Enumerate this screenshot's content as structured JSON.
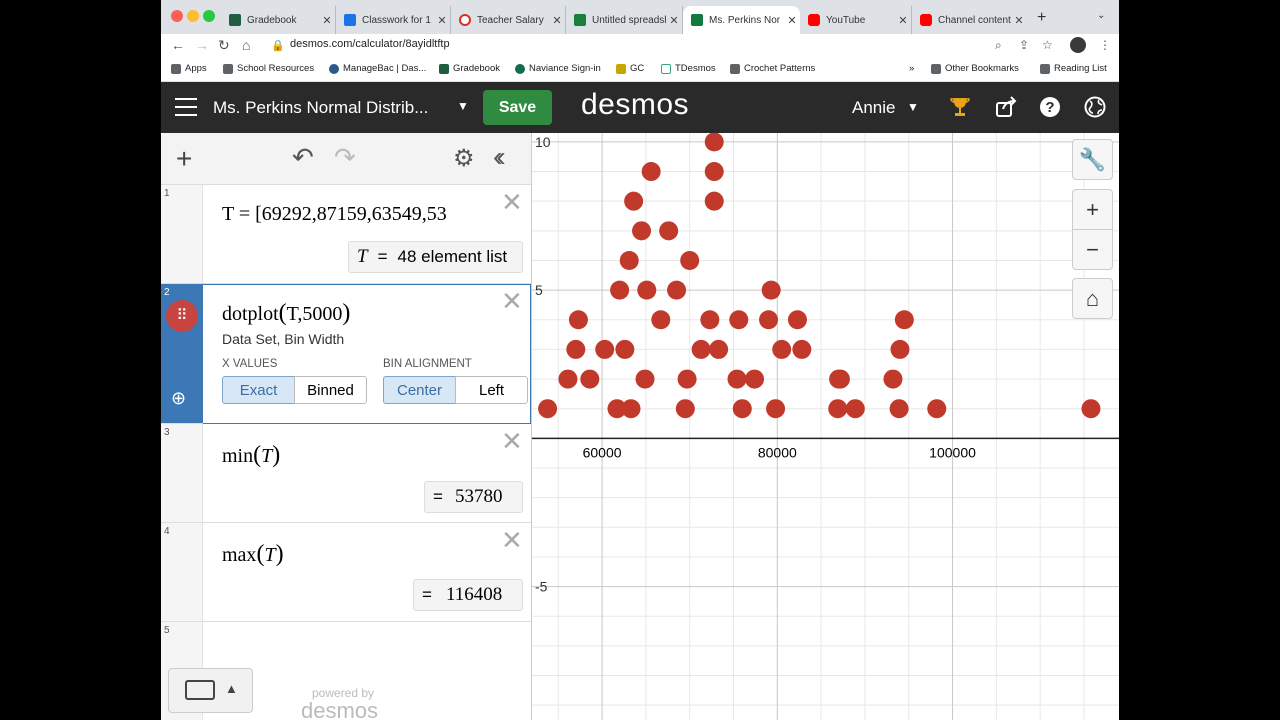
{
  "browser": {
    "tabs": [
      {
        "title": "Gradebook",
        "icon": "gradebook-favicon",
        "color": "#1e5d3f"
      },
      {
        "title": "Classwork for 1",
        "icon": "classroom-favicon",
        "color": "#1a73e8"
      },
      {
        "title": "Teacher Salary",
        "icon": "youtube-favicon",
        "color": "#d93025"
      },
      {
        "title": "Untitled spreadsh",
        "icon": "sheets-favicon",
        "color": "#188038"
      },
      {
        "title": "Ms. Perkins Nor",
        "icon": "desmos-favicon",
        "color": "#127a3e"
      },
      {
        "title": "YouTube",
        "icon": "youtube-favicon",
        "color": "#ff0000"
      },
      {
        "title": "Channel content",
        "icon": "youtube-favicon",
        "color": "#ff0000"
      }
    ],
    "url": "desmos.com/calculator/8ayidltftp",
    "bookmarks": [
      "Apps",
      "School Resources",
      "ManageBac | Das...",
      "Gradebook",
      "Naviance Sign-in",
      "GC",
      "TDesmos",
      "Crochet Patterns"
    ],
    "overflow": "»",
    "other_bookmarks": "Other Bookmarks",
    "reading_list": "Reading List"
  },
  "header": {
    "title": "Ms. Perkins Normal Distrib...",
    "save_label": "Save",
    "logo": "desmos",
    "user": "Annie"
  },
  "expressions": [
    {
      "index": "1",
      "latex": "T = [69292,87159,63549,53",
      "result_label": "48 element list",
      "result_var": "T"
    },
    {
      "index": "2",
      "function": "dotplot",
      "args": "T,5000",
      "desc": "Data Set, Bin Width",
      "xvalues_label": "X VALUES",
      "xvalues_options": [
        "Exact",
        "Binned"
      ],
      "xvalues_selected": "Exact",
      "binalign_label": "BIN ALIGNMENT",
      "binalign_options": [
        "Center",
        "Left"
      ],
      "binalign_selected": "Center"
    },
    {
      "index": "3",
      "function": "min",
      "arg": "T",
      "result": "53780"
    },
    {
      "index": "4",
      "function": "max",
      "arg": "T",
      "result": "116408"
    },
    {
      "index": "5"
    }
  ],
  "footer": {
    "powered": "powered by",
    "logo": "desmos"
  },
  "chart_data": {
    "type": "scatter",
    "title": "",
    "xlabel": "",
    "ylabel": "",
    "xlim": [
      52000,
      119000
    ],
    "ylim": [
      -9.5,
      10.3
    ],
    "x_ticks": [
      60000,
      80000,
      100000
    ],
    "y_ticks": [
      10,
      5,
      -5
    ],
    "color": "#c0392b",
    "grid": true,
    "series": [
      {
        "points": [
          [
            53780,
            1
          ],
          [
            56100,
            2
          ],
          [
            57000,
            3
          ],
          [
            57300,
            4
          ],
          [
            58600,
            2
          ],
          [
            60300,
            3
          ],
          [
            61700,
            1
          ],
          [
            62000,
            5
          ],
          [
            63300,
            1
          ],
          [
            62600,
            3
          ],
          [
            63100,
            6
          ],
          [
            63600,
            8
          ],
          [
            64500,
            7
          ],
          [
            64900,
            2
          ],
          [
            65100,
            5
          ],
          [
            65600,
            9
          ],
          [
            66700,
            4
          ],
          [
            67600,
            7
          ],
          [
            68500,
            5
          ],
          [
            69500,
            1
          ],
          [
            69700,
            2
          ],
          [
            70000,
            6
          ],
          [
            71300,
            3
          ],
          [
            72300,
            4
          ],
          [
            72800,
            10
          ],
          [
            72800,
            9
          ],
          [
            72800,
            8
          ],
          [
            73300,
            3
          ],
          [
            75400,
            2
          ],
          [
            75600,
            4
          ],
          [
            76000,
            1
          ],
          [
            77400,
            2
          ],
          [
            79000,
            4
          ],
          [
            79300,
            5
          ],
          [
            79800,
            1
          ],
          [
            80500,
            3
          ],
          [
            82300,
            4
          ],
          [
            82800,
            3
          ],
          [
            86900,
            1
          ],
          [
            87200,
            2
          ],
          [
            88900,
            1
          ],
          [
            93200,
            2
          ],
          [
            93900,
            1
          ],
          [
            94000,
            3
          ],
          [
            94500,
            4
          ],
          [
            98200,
            1
          ],
          [
            115800,
            1
          ],
          [
            87000,
            2
          ]
        ]
      }
    ]
  }
}
